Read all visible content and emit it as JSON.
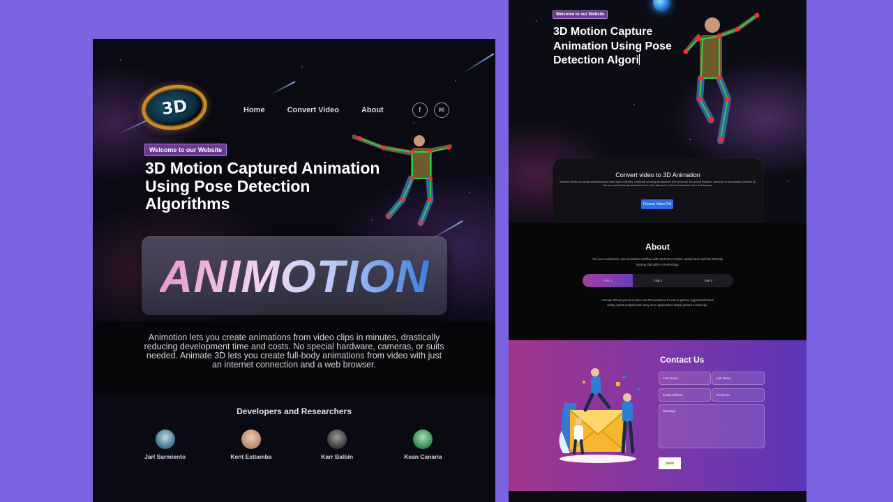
{
  "left": {
    "logo_text": "3D",
    "nav": {
      "home": "Home",
      "convert": "Convert Video",
      "about": "About"
    },
    "social": {
      "facebook": "f",
      "email": "✉"
    },
    "badge": "Welcome to our Website",
    "hero_title": "3D Motion Captured Animation Using Pose Detection Algorithms",
    "brand_word": "ANIMOTION",
    "description": "Animotion lets you create animations from video clips in minutes, drastically reducing development time and costs. No special hardware, cameras, or suits needed. Animate 3D lets you create full-body animations from video with just an internet connection and a web browser.",
    "developers_title": "Developers and Researchers",
    "developers": [
      {
        "name": "Jarl Sarmiento",
        "avatar_color": "#3a6f8c"
      },
      {
        "name": "Kent Estiamba",
        "avatar_color": "#b88a70"
      },
      {
        "name": "Karr Balbin",
        "avatar_color": "#5a5a5a"
      },
      {
        "name": "Kean Canaria",
        "avatar_color": "#2f8a4a"
      }
    ]
  },
  "right": {
    "badge": "Welcome to our Website",
    "hero_title": "3D Motion Capture Animation Using Pose Detection Algori",
    "convert": {
      "title": "Convert video to 3D Animation",
      "text": "Animate 3D lets you create animations from video clips in minutes, drastically reducing development time and costs. No special hardware, cameras, or suits needed. Animate 3D lets you create full-body animations from video with just an internet connection and a web browser.",
      "button": "Choose Video File"
    },
    "about": {
      "title": "About",
      "text": "You can revolutionize your animation workflow with markerless motion capture and real-time 3D body tracking that utilize AI technology.",
      "tabs": [
        "TAB 1",
        "TAB 2",
        "TAB 3"
      ],
      "active_tab": 0,
      "tab_text": "Animate 3D lets you turn video into 3D animations for use in games, augmented/virtual reality, sports analysis and many more applications simply upload a video clip."
    },
    "contact": {
      "title": "Contact Us",
      "first_name": "First Name",
      "last_name": "Last Name",
      "email": "Email Address",
      "phone": "Phone No.",
      "message": "Message",
      "send": "Send"
    }
  }
}
